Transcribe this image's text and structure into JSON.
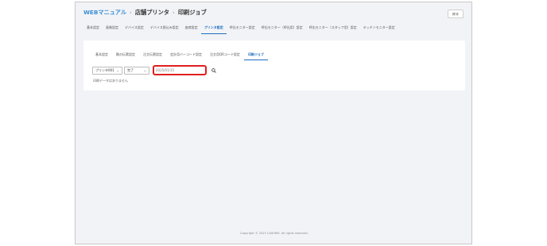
{
  "breadcrumb": {
    "root": "WEBマニュアル",
    "section": "店舗プリンタ",
    "current": "印刷ジョブ",
    "separator": "›"
  },
  "header": {
    "back_label": "戻る"
  },
  "top_tabs": [
    {
      "label": "基本設定"
    },
    {
      "label": "画像設定"
    },
    {
      "label": "デバイス設定"
    },
    {
      "label": "デバイス割込み設定"
    },
    {
      "label": "座席設定"
    },
    {
      "label": "プリンタ設定",
      "active": true
    },
    {
      "label": "呼出モニター設定"
    },
    {
      "label": "呼出モニター（呼出用）設定"
    },
    {
      "label": "呼出モニター（スタッフ用）設定"
    },
    {
      "label": "キッチンモニター設定"
    }
  ],
  "sub_tabs": [
    {
      "label": "基本設定"
    },
    {
      "label": "靴の伝票設定"
    },
    {
      "label": "注文伝票設定"
    },
    {
      "label": "会計用バーコード設定"
    },
    {
      "label": "注文用QRコード設定"
    },
    {
      "label": "印刷ジョブ",
      "active": true
    }
  ],
  "filters": {
    "printer_select": "プリンタ001",
    "status_select": "完了",
    "date_value": "2025/01/15"
  },
  "results": {
    "empty_message": "印刷データはありません"
  },
  "footer": {
    "copyright": "Copyright © 2025 CASHIER. All rights reserved."
  },
  "colors": {
    "accent": "#1c6fbf",
    "highlight": "#e01e1e",
    "background": "#f2f3f7"
  },
  "icons": {
    "search": "search-icon",
    "dropdown": "chevron-down-icon"
  }
}
